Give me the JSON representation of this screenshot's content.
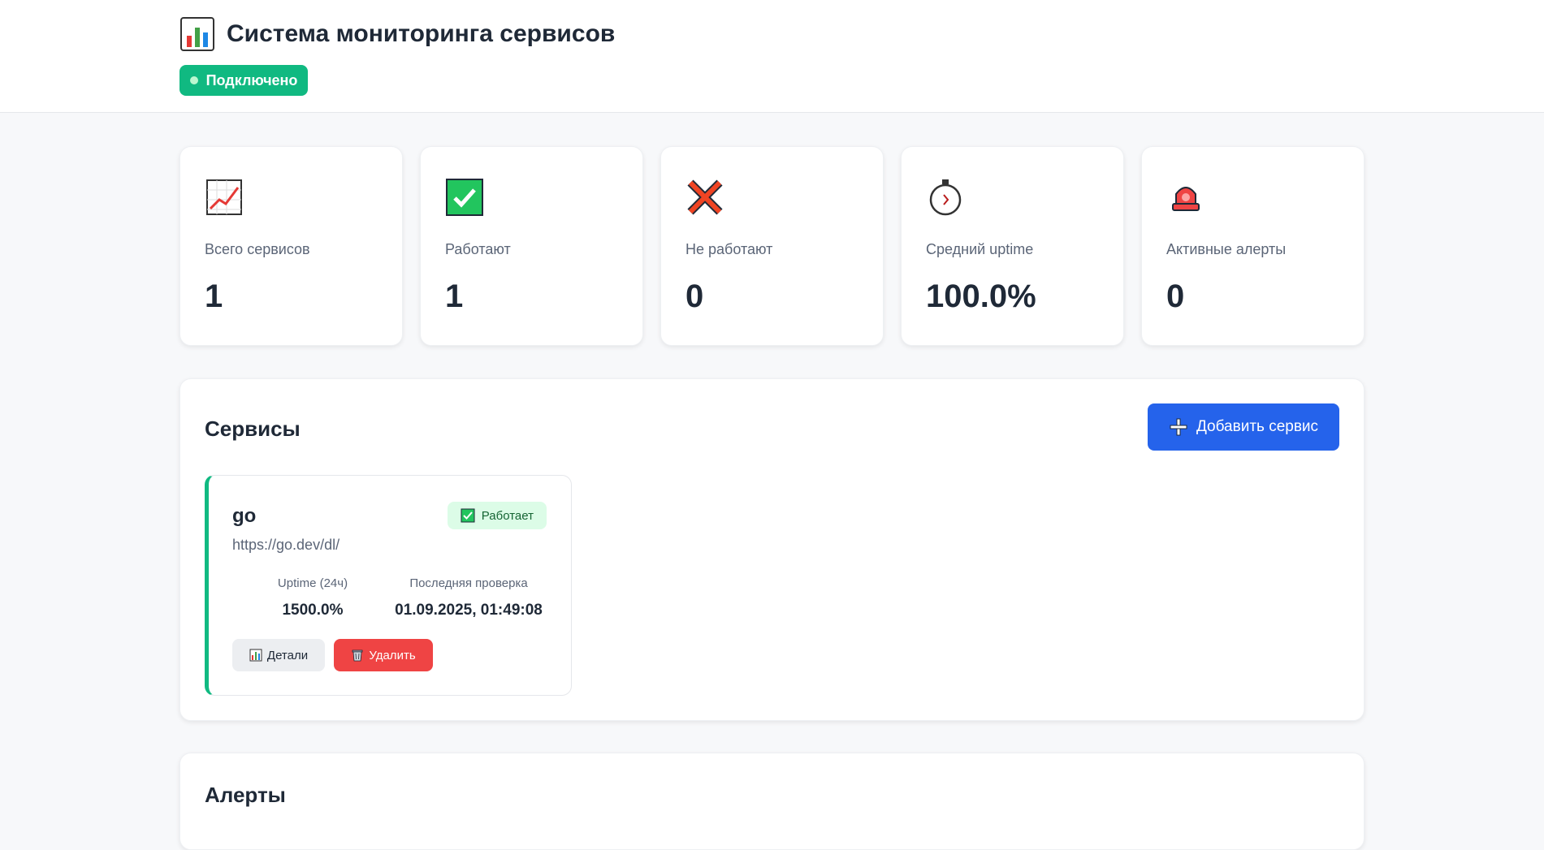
{
  "header": {
    "title": "Система мониторинга сервисов",
    "title_icon": "bar-chart-icon",
    "connection_status": "Подключено"
  },
  "stats": [
    {
      "icon": "chart-increasing-icon",
      "label": "Всего сервисов",
      "value": "1"
    },
    {
      "icon": "check-mark-icon",
      "label": "Работают",
      "value": "1"
    },
    {
      "icon": "cross-mark-icon",
      "label": "Не работают",
      "value": "0"
    },
    {
      "icon": "stopwatch-icon",
      "label": "Средний uptime",
      "value": "100.0%"
    },
    {
      "icon": "siren-icon",
      "label": "Активные алерты",
      "value": "0"
    }
  ],
  "services": {
    "title": "Сервисы",
    "add_button": "Добавить сервис",
    "items": [
      {
        "name": "go",
        "url": "https://go.dev/dl/",
        "status": "Работает",
        "uptime_label": "Uptime (24ч)",
        "uptime_value": "1500.0%",
        "last_check_label": "Последняя проверка",
        "last_check_value": "01.09.2025, 01:49:08",
        "details_button": "Детали",
        "delete_button": "Удалить"
      }
    ]
  },
  "alerts": {
    "title": "Алерты"
  },
  "colors": {
    "connected": "#10b981",
    "primary": "#2563eb",
    "danger": "#ef4444",
    "status_ok_bg": "#dcfce7"
  }
}
